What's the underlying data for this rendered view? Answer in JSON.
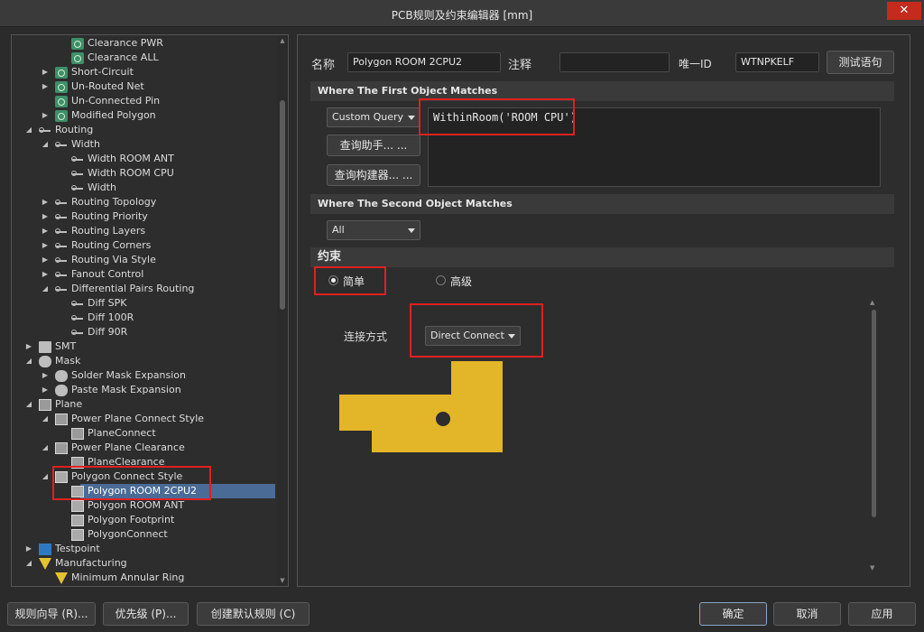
{
  "window": {
    "title": "PCB规则及约束编辑器 [mm]",
    "close_label": "✕"
  },
  "tree": [
    {
      "label": "Clearance PWR",
      "icon": "rule-icon",
      "arrow": ""
    },
    {
      "label": "Clearance ALL",
      "icon": "rule-icon",
      "arrow": ""
    },
    {
      "label": "Short-Circuit",
      "icon": "rule-icon",
      "arrow": "▶"
    },
    {
      "label": "Un-Routed Net",
      "icon": "rule-icon",
      "arrow": "▶"
    },
    {
      "label": "Un-Connected Pin",
      "icon": "rule-icon",
      "arrow": ""
    },
    {
      "label": "Modified Polygon",
      "icon": "rule-icon",
      "arrow": "▶"
    },
    {
      "label": "Routing",
      "icon": "routing-icon",
      "arrow": "◢"
    },
    {
      "label": "Width",
      "icon": "routing-icon",
      "arrow": "◢"
    },
    {
      "label": "Width ROOM ANT",
      "icon": "routing-icon",
      "arrow": ""
    },
    {
      "label": "Width ROOM CPU",
      "icon": "routing-icon",
      "arrow": ""
    },
    {
      "label": "Width",
      "icon": "routing-icon",
      "arrow": ""
    },
    {
      "label": "Routing Topology",
      "icon": "routing-icon",
      "arrow": "▶"
    },
    {
      "label": "Routing Priority",
      "icon": "routing-icon",
      "arrow": "▶"
    },
    {
      "label": "Routing Layers",
      "icon": "routing-icon",
      "arrow": "▶"
    },
    {
      "label": "Routing Corners",
      "icon": "routing-icon",
      "arrow": "▶"
    },
    {
      "label": "Routing Via Style",
      "icon": "routing-icon",
      "arrow": "▶"
    },
    {
      "label": "Fanout Control",
      "icon": "routing-icon",
      "arrow": "▶"
    },
    {
      "label": "Differential Pairs Routing",
      "icon": "routing-icon",
      "arrow": "◢"
    },
    {
      "label": "Diff SPK",
      "icon": "routing-icon",
      "arrow": ""
    },
    {
      "label": "Diff 100R",
      "icon": "routing-icon",
      "arrow": ""
    },
    {
      "label": "Diff 90R",
      "icon": "routing-icon",
      "arrow": ""
    },
    {
      "label": "SMT",
      "icon": "smt-icon",
      "arrow": "▶"
    },
    {
      "label": "Mask",
      "icon": "mask-icon",
      "arrow": "◢"
    },
    {
      "label": "Solder Mask Expansion",
      "icon": "mask-icon",
      "arrow": "▶"
    },
    {
      "label": "Paste Mask Expansion",
      "icon": "mask-icon",
      "arrow": "▶"
    },
    {
      "label": "Plane",
      "icon": "plane-icon",
      "arrow": "◢"
    },
    {
      "label": "Power Plane Connect Style",
      "icon": "plane-icon",
      "arrow": "◢"
    },
    {
      "label": "PlaneConnect",
      "icon": "plane-icon",
      "arrow": ""
    },
    {
      "label": "Power Plane Clearance",
      "icon": "plane-icon",
      "arrow": "◢"
    },
    {
      "label": "PlaneClearance",
      "icon": "plane-icon",
      "arrow": ""
    },
    {
      "label": "Polygon Connect Style",
      "icon": "polygon-icon",
      "arrow": "◢"
    },
    {
      "label": "Polygon ROOM 2CPU2",
      "icon": "polygon-icon",
      "arrow": "",
      "selected": true
    },
    {
      "label": "Polygon ROOM ANT",
      "icon": "polygon-icon",
      "arrow": ""
    },
    {
      "label": "Polygon Footprint",
      "icon": "polygon-icon",
      "arrow": ""
    },
    {
      "label": "PolygonConnect",
      "icon": "polygon-icon",
      "arrow": ""
    },
    {
      "label": "Testpoint",
      "icon": "testpoint-icon",
      "arrow": "▶"
    },
    {
      "label": "Manufacturing",
      "icon": "manufacturing-icon",
      "arrow": "◢"
    },
    {
      "label": "Minimum Annular Ring",
      "icon": "manufacturing-icon",
      "arrow": ""
    }
  ],
  "rule": {
    "name_label": "名称",
    "name_value": "Polygon ROOM 2CPU2",
    "comment_label": "注释",
    "comment_value": "",
    "uid_label": "唯一ID",
    "uid_value": "WTNPKELF",
    "test_button": "测试语句"
  },
  "first_match": {
    "header": "Where The First Object Matches",
    "mode": "Custom Query",
    "query_helper_button": "查询助手... ...",
    "query_builder_button": "查询构建器... ...",
    "query_text": "WithinRoom('ROOM CPU')"
  },
  "second_match": {
    "header": "Where The Second Object Matches",
    "mode": "All"
  },
  "constraints": {
    "header": "约束",
    "simple_label": "简单",
    "advanced_label": "高级",
    "connect_label": "连接方式",
    "connect_value": "Direct Connect"
  },
  "footer": {
    "rule_wizard": "规则向导 (R)...",
    "priorities": "优先级 (P)...",
    "create_default": "创建默认规则 (C)",
    "ok": "确定",
    "cancel": "取消",
    "apply": "应用"
  },
  "colors": {
    "polygon": "#e3b528",
    "selected": "#4a6b96",
    "highlight": "#e02020"
  }
}
